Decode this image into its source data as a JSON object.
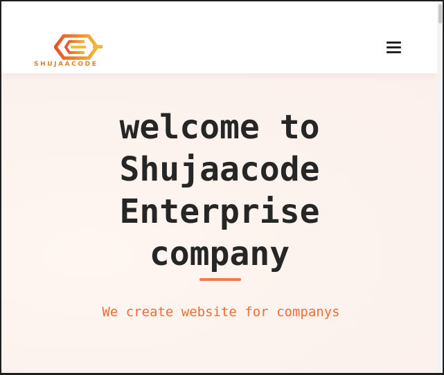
{
  "navbar": {
    "logo_text": "SHUJAACODE",
    "menu_icon": "hamburger-menu-icon"
  },
  "hero": {
    "title": "welcome to Shujaacode Enterprise company",
    "subtitle": "We create website for companys"
  },
  "colors": {
    "accent": "#f06a34",
    "logo_orange": "#e0802a",
    "title_text": "#262626",
    "hero_background": "#fdf3ee"
  }
}
